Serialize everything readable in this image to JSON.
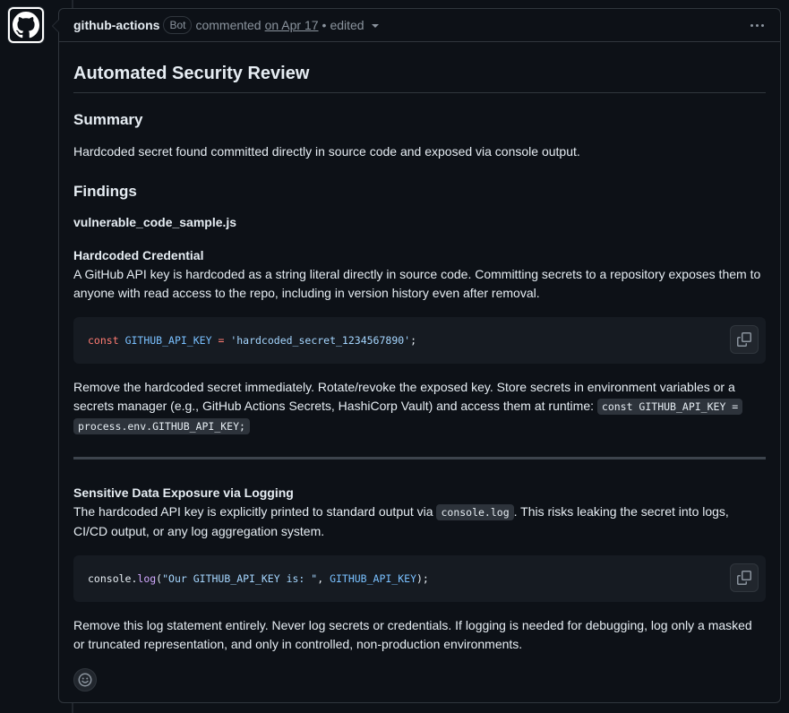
{
  "comment": {
    "author": "github-actions",
    "badge": "Bot",
    "action": "commented",
    "date": "on Apr 17",
    "separator": "•",
    "edited": "edited"
  },
  "review": {
    "title": "Automated Security Review",
    "summary_heading": "Summary",
    "summary_text": "Hardcoded secret found committed directly in source code and exposed via console output.",
    "findings_heading": "Findings",
    "file_name": "vulnerable_code_sample.js",
    "finding1": {
      "title": "Hardcoded Credential",
      "description": "A GitHub API key is hardcoded as a string literal directly in source code. Committing secrets to a repository exposes them to anyone with read access to the repo, including in version history even after removal.",
      "code": {
        "keyword": "const",
        "variable": "GITHUB_API_KEY",
        "operator": "=",
        "string": "'hardcoded_secret_1234567890'",
        "end": ";"
      },
      "remediation": "Remove the hardcoded secret immediately. Rotate/revoke the exposed key. Store secrets in environment variables or a secrets manager (e.g., GitHub Actions Secrets, HashiCorp Vault) and access them at runtime:",
      "inline_code_line1": "const GITHUB_API_KEY =",
      "inline_code_line2": "process.env.GITHUB_API_KEY;"
    },
    "finding2": {
      "title": "Sensitive Data Exposure via Logging",
      "description_before": "The hardcoded API key is explicitly printed to standard output via",
      "inline_code": "console.log",
      "description_after": ". This risks leaking the secret into logs, CI/CD output, or any log aggregation system.",
      "code": {
        "object": "console.",
        "method": "log",
        "open": "(",
        "string": "\"Our GITHUB_API_KEY is: \"",
        "comma": ", ",
        "variable": "GITHUB_API_KEY",
        "close": ");"
      },
      "remediation": "Remove this log statement entirely. Never log secrets or credentials. If logging is needed for debugging, log only a masked or truncated representation, and only in controlled, non-production environments."
    }
  },
  "icons": {
    "avatar": "github-mark-icon",
    "menu": "kebab-horizontal-icon",
    "copy": "copy-icon",
    "reaction": "smiley-icon"
  },
  "colors": {
    "background": "#0d1117",
    "border": "#30363d",
    "code_bg": "#161b22",
    "keyword": "#ff7b72",
    "variable": "#79c0ff",
    "string": "#a5d6ff",
    "function": "#d2a8ff"
  }
}
